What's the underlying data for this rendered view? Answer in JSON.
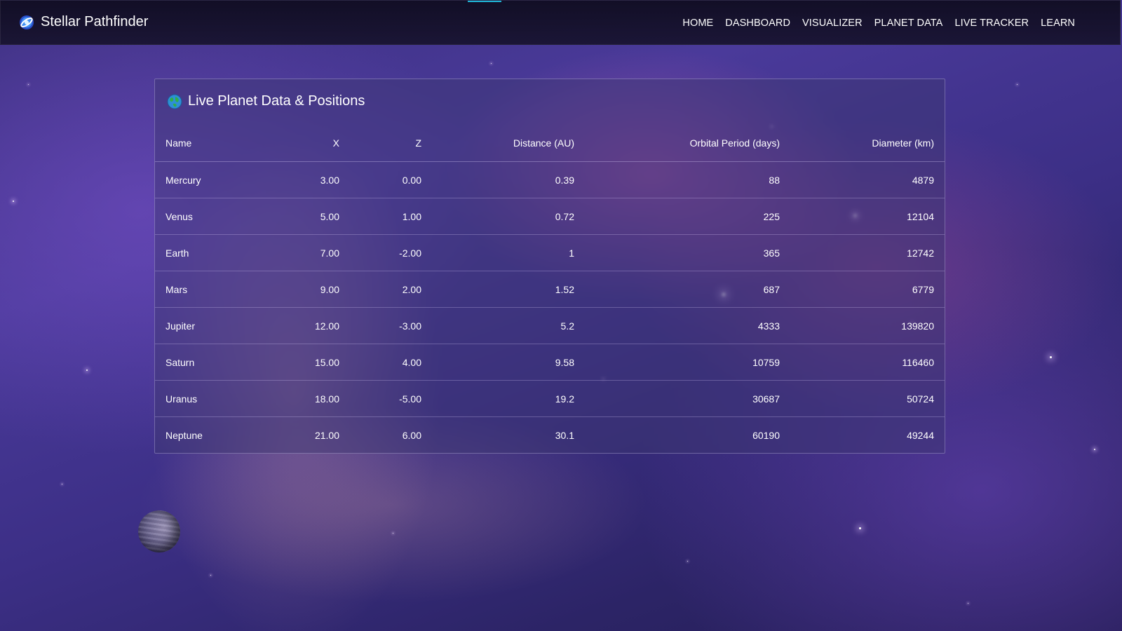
{
  "app": {
    "brand_name": "Stellar Pathfinder",
    "accent_color": "#1fb6d8"
  },
  "nav": {
    "links": [
      "HOME",
      "DASHBOARD",
      "VISUALIZER",
      "PLANET DATA",
      "LIVE TRACKER",
      "LEARN"
    ]
  },
  "panel": {
    "title": "Live Planet Data & Positions",
    "icon": "globe-icon"
  },
  "table": {
    "headers": [
      "Name",
      "X",
      "Z",
      "Distance (AU)",
      "Orbital Period (days)",
      "Diameter (km)"
    ],
    "rows": [
      [
        "Mercury",
        "3.00",
        "0.00",
        "0.39",
        "88",
        "4879"
      ],
      [
        "Venus",
        "5.00",
        "1.00",
        "0.72",
        "225",
        "12104"
      ],
      [
        "Earth",
        "7.00",
        "-2.00",
        "1",
        "365",
        "12742"
      ],
      [
        "Mars",
        "9.00",
        "2.00",
        "1.52",
        "687",
        "6779"
      ],
      [
        "Jupiter",
        "12.00",
        "-3.00",
        "5.2",
        "4333",
        "139820"
      ],
      [
        "Saturn",
        "15.00",
        "4.00",
        "9.58",
        "10759",
        "116460"
      ],
      [
        "Uranus",
        "18.00",
        "-5.00",
        "19.2",
        "30687",
        "50724"
      ],
      [
        "Neptune",
        "21.00",
        "6.00",
        "30.1",
        "60190",
        "49244"
      ]
    ]
  }
}
